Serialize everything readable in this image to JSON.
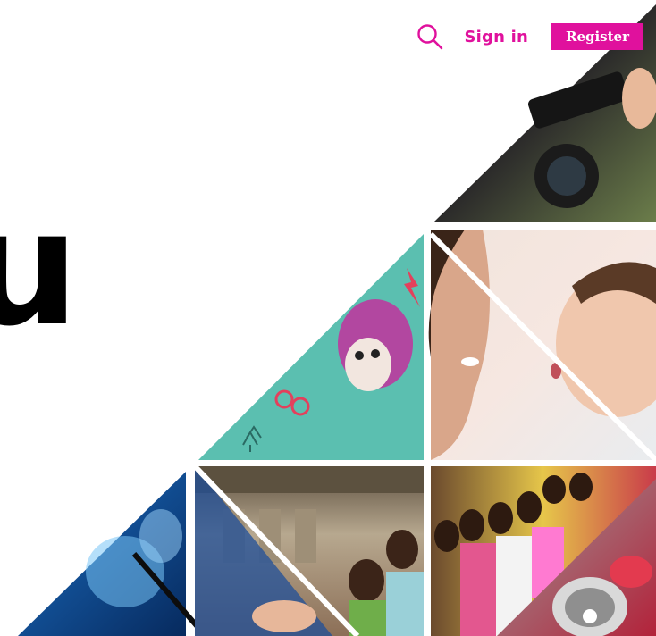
{
  "header": {
    "search_icon": "search-icon",
    "signin_label": "Sign in",
    "register_label": "Register",
    "accent_color": "#e0119d"
  },
  "hero": {
    "heading_fragment": "u"
  },
  "mosaic": {
    "tiles": [
      {
        "name": "camera-operator-photo",
        "icon": "camera-icon"
      },
      {
        "name": "illustrated-girl-glasses-tile",
        "icon": "illustration-icon"
      },
      {
        "name": "mother-baby-photo",
        "icon": "photo-icon"
      },
      {
        "name": "brain-scan-photo",
        "icon": "xray-icon"
      },
      {
        "name": "children-building-photo",
        "icon": "photo-icon"
      },
      {
        "name": "children-group-photo",
        "icon": "photo-icon"
      },
      {
        "name": "megaphone-photo",
        "icon": "megaphone-icon"
      }
    ]
  }
}
